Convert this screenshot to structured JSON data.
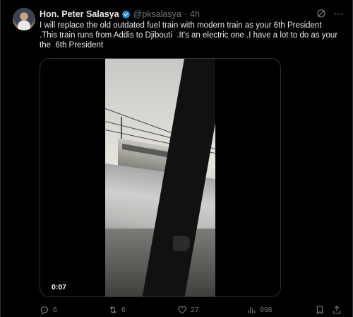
{
  "tweet": {
    "author_name": "Hon. Peter Salasya",
    "handle": "@pksalasya",
    "separator": "·",
    "time": "4h",
    "text": "I will replace the old outdated fuel train with modern train as your 6th President\n.This train runs from Addis to Djibouti  .It's an electric one .I have a lot to do as your\nthe  6th President",
    "more_icon": "⋯"
  },
  "media": {
    "timestamp": "0:07"
  },
  "actions": {
    "replies": "6",
    "reposts": "6",
    "likes": "27",
    "views": "998"
  },
  "colors": {
    "background": "#000000",
    "text": "#e7e9ea",
    "muted": "#71767b",
    "verified": "#1d9bf0",
    "border": "#2f3336"
  }
}
